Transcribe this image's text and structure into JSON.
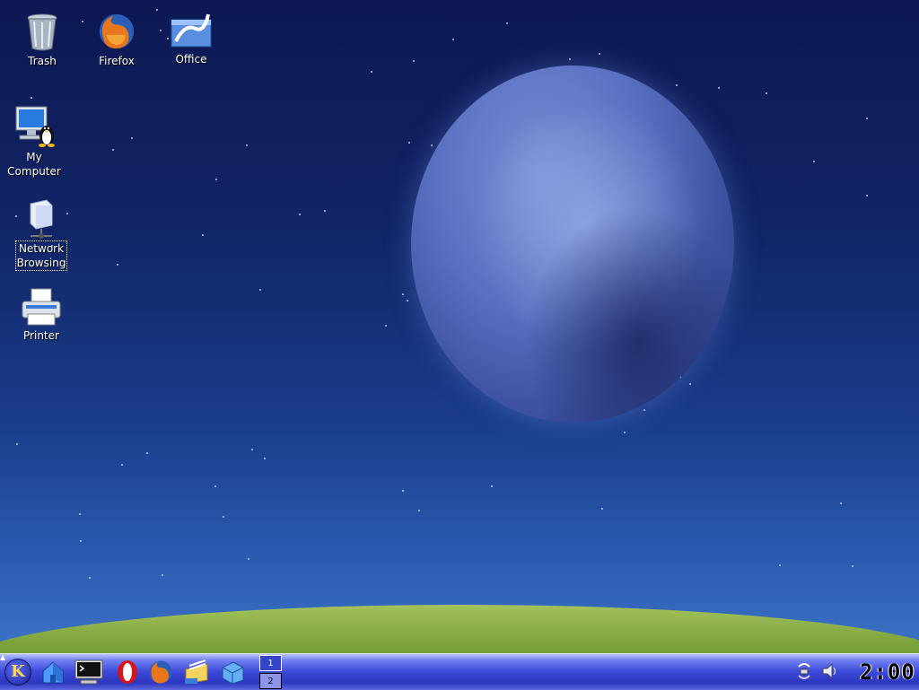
{
  "desktop": {
    "icons": [
      {
        "label": "Trash",
        "icon": "trash-icon"
      },
      {
        "label": "Firefox",
        "icon": "firefox-icon"
      },
      {
        "label": "Office",
        "icon": "office-icon"
      },
      {
        "label": "My\nComputer",
        "icon": "computer-icon"
      },
      {
        "label": "Network\nBrowsing",
        "icon": "network-icon"
      },
      {
        "label": "Printer",
        "icon": "printer-icon"
      }
    ]
  },
  "panel": {
    "launchers": [
      {
        "name": "k-menu-icon",
        "glyph": "K"
      },
      {
        "name": "home-folder-icon"
      },
      {
        "name": "terminal-icon"
      },
      {
        "name": "opera-icon"
      },
      {
        "name": "firefox-icon"
      },
      {
        "name": "mail-icon"
      },
      {
        "name": "package-icon"
      }
    ],
    "pager": {
      "desktops": [
        "1",
        "2"
      ],
      "active": "1"
    },
    "tray": [
      "network-update-icon",
      "volume-icon"
    ],
    "clock": "2:00"
  },
  "colors": {
    "panel": "#3c48d8",
    "sky_top": "#0d1853",
    "sky_bottom": "#3d73c6",
    "grass": "#7ea33d"
  }
}
